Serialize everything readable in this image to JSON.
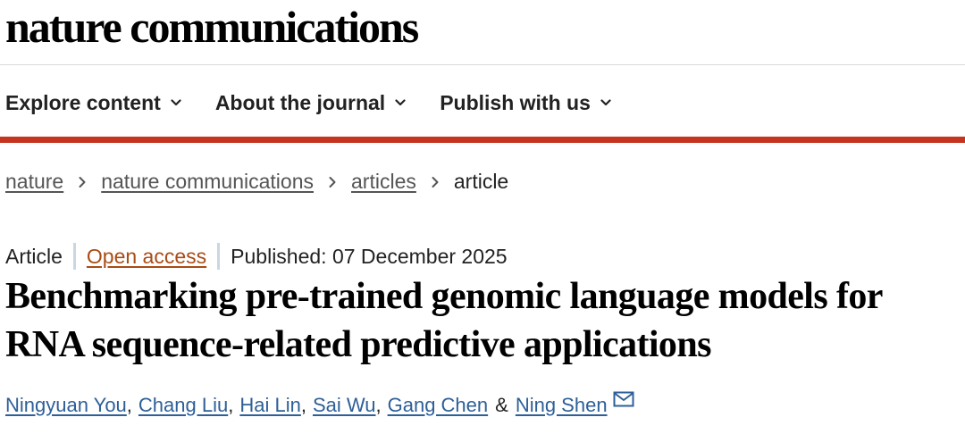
{
  "header": {
    "brand": "nature communications"
  },
  "nav": {
    "items": [
      {
        "label": "Explore content"
      },
      {
        "label": "About the journal"
      },
      {
        "label": "Publish with us"
      }
    ]
  },
  "breadcrumb": {
    "items": [
      {
        "label": "nature"
      },
      {
        "label": "nature communications"
      },
      {
        "label": "articles"
      }
    ],
    "current": "article"
  },
  "article": {
    "type": "Article",
    "access": "Open access",
    "published": "Published: 07 December 2025",
    "title": "Benchmarking pre-trained genomic language models for RNA sequence-related predictive applications",
    "authors": [
      {
        "name": "Ningyuan You"
      },
      {
        "name": "Chang Liu"
      },
      {
        "name": "Hai Lin"
      },
      {
        "name": "Sai Wu"
      },
      {
        "name": "Gang Chen"
      },
      {
        "name": "Ning Shen"
      }
    ],
    "and_symbol": "&",
    "separator": ","
  },
  "colors": {
    "accent_bar": "#c4341f",
    "open_access": "#a94c16",
    "author_link": "#2e5f98"
  }
}
